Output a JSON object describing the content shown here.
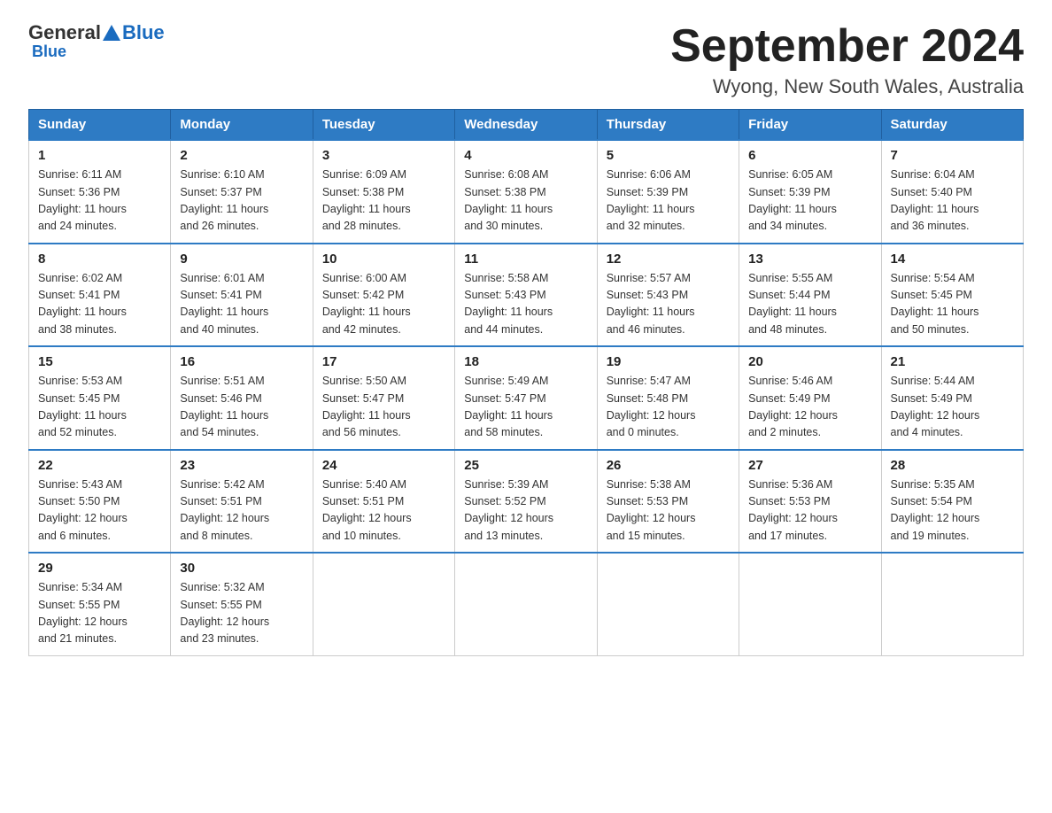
{
  "header": {
    "logo_general": "General",
    "logo_blue": "Blue",
    "month_title": "September 2024",
    "location": "Wyong, New South Wales, Australia"
  },
  "days_of_week": [
    "Sunday",
    "Monday",
    "Tuesday",
    "Wednesday",
    "Thursday",
    "Friday",
    "Saturday"
  ],
  "weeks": [
    [
      {
        "day": "1",
        "sunrise": "6:11 AM",
        "sunset": "5:36 PM",
        "daylight": "11 hours and 24 minutes."
      },
      {
        "day": "2",
        "sunrise": "6:10 AM",
        "sunset": "5:37 PM",
        "daylight": "11 hours and 26 minutes."
      },
      {
        "day": "3",
        "sunrise": "6:09 AM",
        "sunset": "5:38 PM",
        "daylight": "11 hours and 28 minutes."
      },
      {
        "day": "4",
        "sunrise": "6:08 AM",
        "sunset": "5:38 PM",
        "daylight": "11 hours and 30 minutes."
      },
      {
        "day": "5",
        "sunrise": "6:06 AM",
        "sunset": "5:39 PM",
        "daylight": "11 hours and 32 minutes."
      },
      {
        "day": "6",
        "sunrise": "6:05 AM",
        "sunset": "5:39 PM",
        "daylight": "11 hours and 34 minutes."
      },
      {
        "day": "7",
        "sunrise": "6:04 AM",
        "sunset": "5:40 PM",
        "daylight": "11 hours and 36 minutes."
      }
    ],
    [
      {
        "day": "8",
        "sunrise": "6:02 AM",
        "sunset": "5:41 PM",
        "daylight": "11 hours and 38 minutes."
      },
      {
        "day": "9",
        "sunrise": "6:01 AM",
        "sunset": "5:41 PM",
        "daylight": "11 hours and 40 minutes."
      },
      {
        "day": "10",
        "sunrise": "6:00 AM",
        "sunset": "5:42 PM",
        "daylight": "11 hours and 42 minutes."
      },
      {
        "day": "11",
        "sunrise": "5:58 AM",
        "sunset": "5:43 PM",
        "daylight": "11 hours and 44 minutes."
      },
      {
        "day": "12",
        "sunrise": "5:57 AM",
        "sunset": "5:43 PM",
        "daylight": "11 hours and 46 minutes."
      },
      {
        "day": "13",
        "sunrise": "5:55 AM",
        "sunset": "5:44 PM",
        "daylight": "11 hours and 48 minutes."
      },
      {
        "day": "14",
        "sunrise": "5:54 AM",
        "sunset": "5:45 PM",
        "daylight": "11 hours and 50 minutes."
      }
    ],
    [
      {
        "day": "15",
        "sunrise": "5:53 AM",
        "sunset": "5:45 PM",
        "daylight": "11 hours and 52 minutes."
      },
      {
        "day": "16",
        "sunrise": "5:51 AM",
        "sunset": "5:46 PM",
        "daylight": "11 hours and 54 minutes."
      },
      {
        "day": "17",
        "sunrise": "5:50 AM",
        "sunset": "5:47 PM",
        "daylight": "11 hours and 56 minutes."
      },
      {
        "day": "18",
        "sunrise": "5:49 AM",
        "sunset": "5:47 PM",
        "daylight": "11 hours and 58 minutes."
      },
      {
        "day": "19",
        "sunrise": "5:47 AM",
        "sunset": "5:48 PM",
        "daylight": "12 hours and 0 minutes."
      },
      {
        "day": "20",
        "sunrise": "5:46 AM",
        "sunset": "5:49 PM",
        "daylight": "12 hours and 2 minutes."
      },
      {
        "day": "21",
        "sunrise": "5:44 AM",
        "sunset": "5:49 PM",
        "daylight": "12 hours and 4 minutes."
      }
    ],
    [
      {
        "day": "22",
        "sunrise": "5:43 AM",
        "sunset": "5:50 PM",
        "daylight": "12 hours and 6 minutes."
      },
      {
        "day": "23",
        "sunrise": "5:42 AM",
        "sunset": "5:51 PM",
        "daylight": "12 hours and 8 minutes."
      },
      {
        "day": "24",
        "sunrise": "5:40 AM",
        "sunset": "5:51 PM",
        "daylight": "12 hours and 10 minutes."
      },
      {
        "day": "25",
        "sunrise": "5:39 AM",
        "sunset": "5:52 PM",
        "daylight": "12 hours and 13 minutes."
      },
      {
        "day": "26",
        "sunrise": "5:38 AM",
        "sunset": "5:53 PM",
        "daylight": "12 hours and 15 minutes."
      },
      {
        "day": "27",
        "sunrise": "5:36 AM",
        "sunset": "5:53 PM",
        "daylight": "12 hours and 17 minutes."
      },
      {
        "day": "28",
        "sunrise": "5:35 AM",
        "sunset": "5:54 PM",
        "daylight": "12 hours and 19 minutes."
      }
    ],
    [
      {
        "day": "29",
        "sunrise": "5:34 AM",
        "sunset": "5:55 PM",
        "daylight": "12 hours and 21 minutes."
      },
      {
        "day": "30",
        "sunrise": "5:32 AM",
        "sunset": "5:55 PM",
        "daylight": "12 hours and 23 minutes."
      },
      null,
      null,
      null,
      null,
      null
    ]
  ],
  "labels": {
    "sunrise": "Sunrise:",
    "sunset": "Sunset:",
    "daylight": "Daylight:"
  }
}
